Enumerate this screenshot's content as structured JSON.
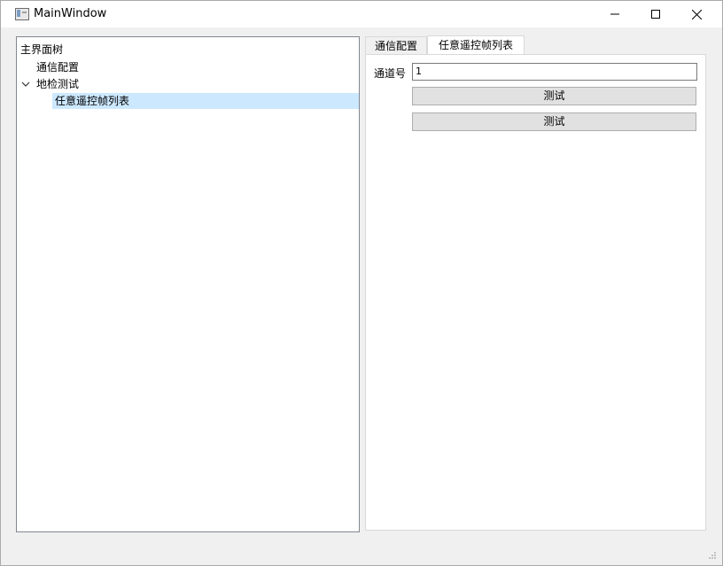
{
  "window": {
    "title": "MainWindow",
    "icon": "app-window-icon",
    "controls": [
      "minimize-icon",
      "maximize-icon",
      "close-icon"
    ]
  },
  "tree": {
    "header": "主界面树",
    "items": [
      {
        "label": "通信配置",
        "level": 1
      },
      {
        "label": "地检测试",
        "level": 1,
        "expanded": true
      },
      {
        "label": "任意遥控帧列表",
        "level": 2,
        "selected": true
      }
    ]
  },
  "tabs": [
    {
      "label": "通信配置",
      "active": false
    },
    {
      "label": "任意遥控帧列表",
      "active": true
    }
  ],
  "form": {
    "channel_label": "通道号",
    "channel_value": "1",
    "buttons": [
      "测试",
      "测试"
    ]
  },
  "colors": {
    "selection": "#cce8ff",
    "button_bg": "#e1e1e1",
    "window_bg": "#f0f0f0"
  }
}
